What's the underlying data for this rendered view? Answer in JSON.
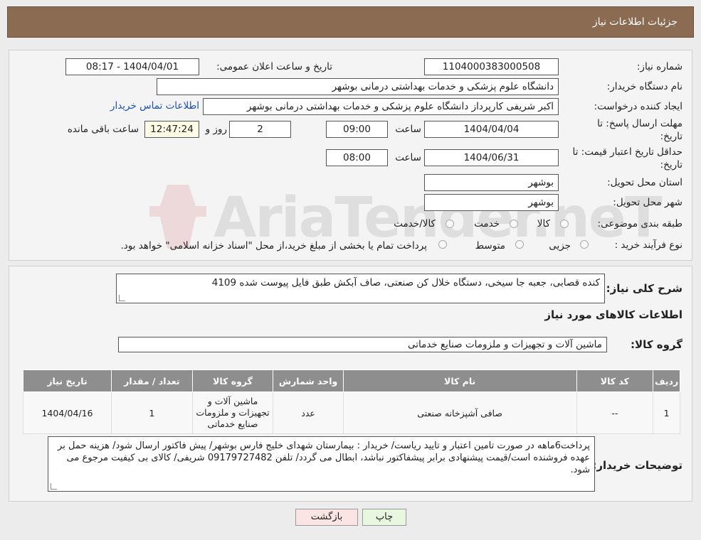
{
  "header": {
    "title": "جزئیات اطلاعات نیاز"
  },
  "fields": {
    "need_number_label": "شماره نیاز:",
    "need_number": "1104000383000508",
    "announce_label": "تاریخ و ساعت اعلان عمومی:",
    "announce_value": "1404/04/01 - 08:17",
    "buyer_org_label": "نام دستگاه خریدار:",
    "buyer_org": "دانشگاه علوم پزشکی و خدمات بهداشتی درمانی بوشهر",
    "creator_label": "ایجاد کننده درخواست:",
    "creator": "اکبر شریفی کارپرداز دانشگاه علوم پزشکی و خدمات بهداشتی درمانی بوشهر",
    "contact_link": "اطلاعات تماس خریدار",
    "send_deadline_label_1": "مهلت ارسال پاسخ: تا",
    "send_deadline_label_2": "تاریخ:",
    "send_date": "1404/04/04",
    "time_label": "ساعت",
    "send_time": "09:00",
    "days_value": "2",
    "days_label": "روز و",
    "remaining_time": "12:47:24",
    "remaining_label": "ساعت باقی مانده",
    "validity_label_1": "حداقل تاریخ اعتبار قیمت: تا",
    "validity_label_2": "تاریخ:",
    "validity_date": "1404/06/31",
    "validity_time": "08:00",
    "province_label": "استان محل تحویل:",
    "province": "بوشهر",
    "city_label": "شهر محل تحویل:",
    "city": "بوشهر",
    "category_label": "طبقه بندی موضوعی:",
    "category_options": [
      "کالا",
      "خدمت",
      "کالا/خدمت"
    ],
    "purchase_type_label": "نوع فرآیند خرید :",
    "purchase_options": [
      "جزیی",
      "متوسط"
    ],
    "purchase_note": "پرداخت تمام یا بخشی از مبلغ خرید،از محل \"اسناد خزانه اسلامی\" خواهد بود."
  },
  "summary": {
    "desc_label": "شرح کلی نیاز:",
    "desc_value": "کنده قصابی، جعبه جا سیخی، دستگاه خلال کن صنعتی، صاف آبکش طبق فایل پیوست شده 4109",
    "goods_info_title": "اطلاعات کالاهای مورد نیاز",
    "goods_group_label": "گروه کالا:",
    "goods_group_value": "ماشین آلات و تجهیزات و ملزومات صنایع خدماتی"
  },
  "table": {
    "headers": [
      "ردیف",
      "کد کالا",
      "نام کالا",
      "واحد شمارش",
      "گروه کالا",
      "تعداد / مقدار",
      "تاریخ نیاز"
    ],
    "rows": [
      [
        "1",
        "--",
        "صافی آشپزخانه صنعتی",
        "عدد",
        "ماشین آلات و تجهیزات و ملزومات صنایع خدماتی",
        "1",
        "1404/04/16"
      ]
    ]
  },
  "buyer_notes": {
    "label": "توضیحات خریدار:",
    "value": "پرداخت6ماهه در صورت تامین اعتبار و تایید ریاست/ خریدار : بیمارستان شهدای خلیج فارس بوشهر/ پیش فاکتور ارسال شود/ هزینه حمل بر عهده فروشنده است/قیمت پیشنهادی برابر پیشفاکتور نباشد، ابطال می گردد/ تلفن 09179727482 شریفی/ کالای بی کیفیت مرجوع می شود."
  },
  "buttons": {
    "print": "چاپ",
    "back": "بازگشت"
  },
  "watermark": {
    "text": "AriaTender.neT"
  },
  "colors": {
    "header": "#8b6b52",
    "table_header": "#8e8e8e",
    "link": "#1a4fb4",
    "print_bg": "#e8f7df",
    "back_bg": "#fbe4e4"
  }
}
